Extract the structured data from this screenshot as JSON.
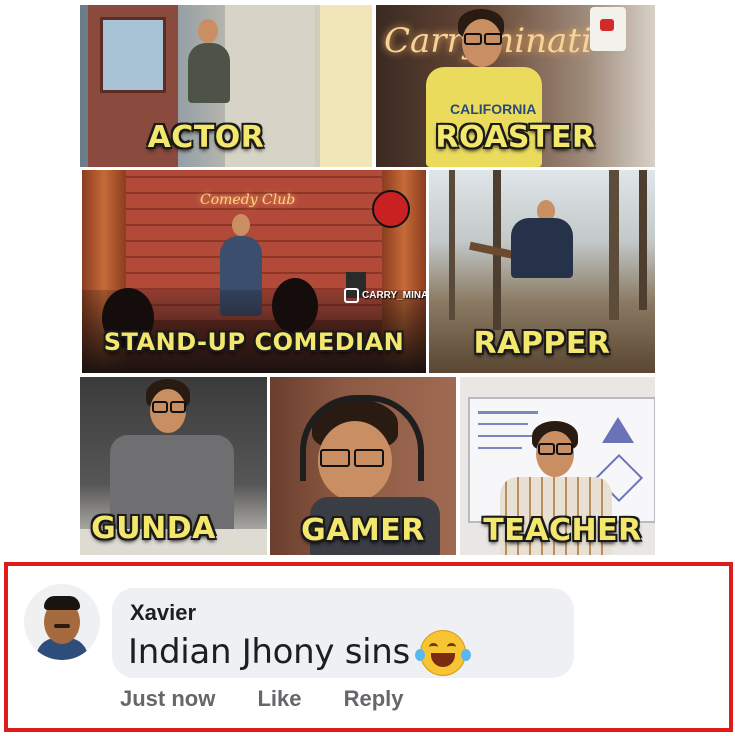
{
  "tiles": [
    {
      "label": "ACTOR"
    },
    {
      "label": "ROASTER"
    },
    {
      "label": "STAND-UP COMEDIAN"
    },
    {
      "label": "RAPPER"
    },
    {
      "label": "GUNDA"
    },
    {
      "label": "GAMER"
    },
    {
      "label": "TEACHER"
    }
  ],
  "watermark": "CARRY_MINATI_FANBOY",
  "roaster_sign": "Carryminati",
  "roaster_shirt": "CALIFORNIA",
  "comment": {
    "author": "Xavier",
    "text": "Indian Jhony sins",
    "emoji": "laughing-face-with-tears",
    "time": "Just now",
    "like": "Like",
    "reply": "Reply"
  },
  "colors": {
    "label": "#f4e76e",
    "frame": "#e01b1b",
    "bubble": "#eef0f3"
  }
}
